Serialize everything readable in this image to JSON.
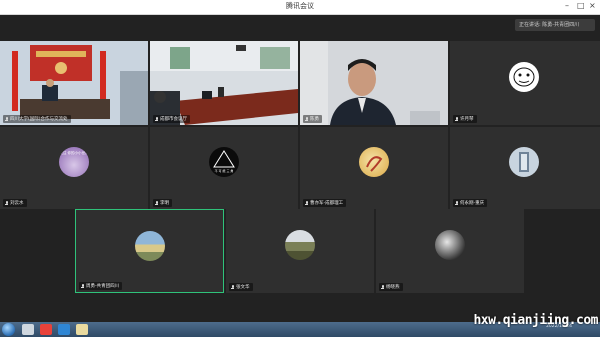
{
  "window": {
    "title": "腾讯会议"
  },
  "toast": {
    "text": "正在讲话: 陈勇-共青团四川"
  },
  "participants": [
    {
      "name": "四川大学(国际)合作与交流处"
    },
    {
      "name": "成都市会议厅"
    },
    {
      "name": "陈勇"
    },
    {
      "name": "许月琴"
    },
    {
      "name": "刘云水"
    },
    {
      "name": "李明"
    },
    {
      "name": "曹亦军-成都理工"
    },
    {
      "name": "何永刚-重庆"
    },
    {
      "name": "周勇-共青团四川"
    },
    {
      "name": "张文华"
    },
    {
      "name": "杨晓燕"
    }
  ],
  "avatars": {
    "p5_caption": "关注 你的小小世界",
    "p6_caption": "不 可 能 三 角"
  },
  "taskbar": {
    "time": "2022/10/24"
  },
  "watermark": "hxw.qianjiing.com"
}
